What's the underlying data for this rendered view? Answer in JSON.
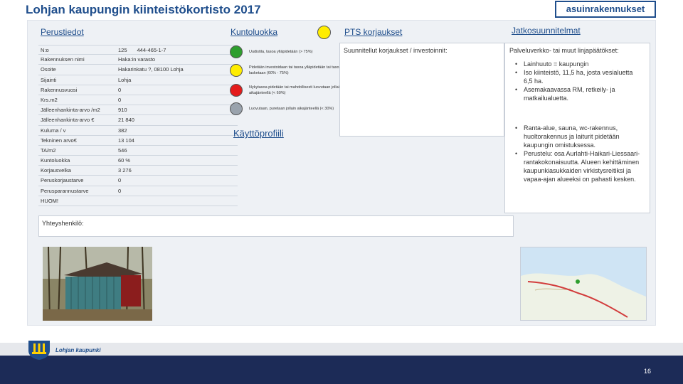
{
  "header": {
    "title": "Lohjan kaupungin kiinteistökortisto 2017",
    "tag_label": "asuinrakennukset"
  },
  "sections": {
    "basic": "Perustiedot",
    "condition": "Kuntoluokka",
    "pts": "PTS korjaukset",
    "plans": "Jatkosuunnitelmat",
    "usage": "Käyttöprofiili"
  },
  "info_rows": [
    {
      "label": "N:o",
      "value": "125",
      "value2": "444-465-1-7"
    },
    {
      "label": "Rakennuksen nimi",
      "value": "Haka:in varasto",
      "value2": ""
    },
    {
      "label": "Osoite",
      "value": "Hakarinkatu ?, 08100 Lohja",
      "value2": ""
    },
    {
      "label": "Sijainti",
      "value": "Lohja",
      "value2": ""
    },
    {
      "label": "Rakennusvuosi",
      "value": "0",
      "value2": ""
    },
    {
      "label": "Krs.m2",
      "value": "0",
      "value2": ""
    },
    {
      "label": "Jälleenhankinta-arvo /m2",
      "value": "910",
      "value2": ""
    },
    {
      "label": "Jälleenhankinta-arvo €",
      "value": "21 840",
      "value2": ""
    },
    {
      "label": "Kuluma / v",
      "value": "382",
      "value2": ""
    },
    {
      "label": "Tekninen arvo€",
      "value": "13 104",
      "value2": ""
    },
    {
      "label": "TA/m2",
      "value": "546",
      "value2": ""
    },
    {
      "label": "Kuntoluokka",
      "value": "60 %",
      "value2": ""
    },
    {
      "label": "Korjausvelka",
      "value": "3 276",
      "value2": ""
    },
    {
      "label": "Peruskorjaustarve",
      "value": "0",
      "value2": ""
    },
    {
      "label": "Perusparannustarve",
      "value": "0",
      "value2": ""
    },
    {
      "label": "HUOM!",
      "value": "",
      "value2": ""
    }
  ],
  "legend": [
    {
      "color": "#2e9e2e",
      "text": "Uudistila, tasoa ylläpidetään (> 75%)"
    },
    {
      "color": "#ffed00",
      "text": "Pidetään investoidaan tai tasoa ylläpidetään tai tasoa lasketaan (60% - 75%)"
    },
    {
      "color": "#e41b1b",
      "text": "Nykytasoa pidetään tai mahdollisesti luovutaan jollain aikajänteellä (< 60%)"
    },
    {
      "color": "#9aa3ad",
      "text": "Luovutaan, puretaan jollain aikajänteellä (< 30%)"
    }
  ],
  "pts_text": "Suunnitellut korjaukset / investoinnit:",
  "plans_lead": "Palveluverkko- tai muut linjapäätökset:",
  "plans_bullets_1": [
    "Lainhuuto = kaupungin",
    "Iso kiinteistö, 11,5 ha, josta vesialuetta 6,5 ha.",
    "Asemakaavassa RM, retkeily- ja matkailualuetta."
  ],
  "plans_bullets_2": [
    "Ranta-alue, sauna, wc-rakennus, huoltorakennus ja laiturit pidetään kaupungin omistuksessa.",
    "Perustelu: osa Aurlahti-Haikari-Liessaari-rantakokonaisuutta. Alueen kehittäminen kaupunkiasukkaiden virkistysreitiksi ja vapaa-ajan alueeksi on pahasti kesken."
  ],
  "contact_label": "Yhteyshenkilö:",
  "footer": {
    "logo_text": "Lohjan kaupunki",
    "slide_number": "16"
  },
  "colors": {
    "brand": "#1f4e8c",
    "footer": "#1c2b57",
    "grade": "#ffed00"
  }
}
